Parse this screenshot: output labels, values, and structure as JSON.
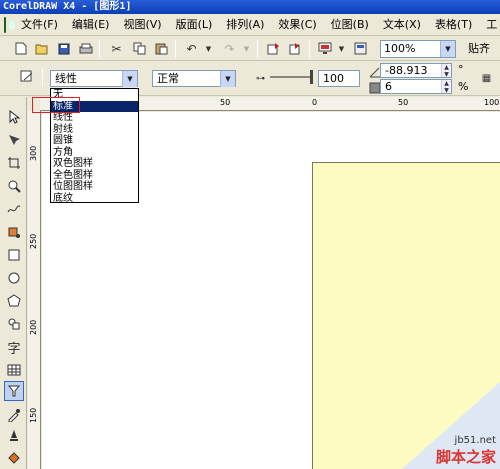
{
  "window": {
    "title": "CorelDRAW X4 - [图形1]"
  },
  "menubar": {
    "items": [
      "文件(F)",
      "编辑(E)",
      "视图(V)",
      "版面(L)",
      "排列(A)",
      "效果(C)",
      "位图(B)",
      "文本(X)",
      "表格(T)",
      "工"
    ]
  },
  "toolbar": {
    "zoom_value": "100%",
    "paste_label": "贴齐"
  },
  "propbar": {
    "fill_type_value": "线性",
    "merge_mode_value": "正常",
    "transparency_value": "100",
    "angle_value": "-88.913",
    "edge_value": "6",
    "degree_symbol": "°",
    "percent_symbol": "%"
  },
  "dropdown": {
    "options": [
      "无",
      "标准",
      "线性",
      "射线",
      "圆锥",
      "方角",
      "双色图样",
      "全色图样",
      "位图图样",
      "底纹"
    ],
    "selected_index": 1
  },
  "ruler": {
    "h_labels": [
      "100",
      "50",
      "0",
      "50",
      "100"
    ],
    "v_labels": [
      "300",
      "250",
      "200",
      "150"
    ]
  },
  "watermark": {
    "site": "jb51.net",
    "name": "脚本之家"
  },
  "colors": {
    "title_bar": "#0a3fb3",
    "selection": "#0a246a",
    "page_fill": "#fcfcc2",
    "highlight": "#e02020"
  }
}
